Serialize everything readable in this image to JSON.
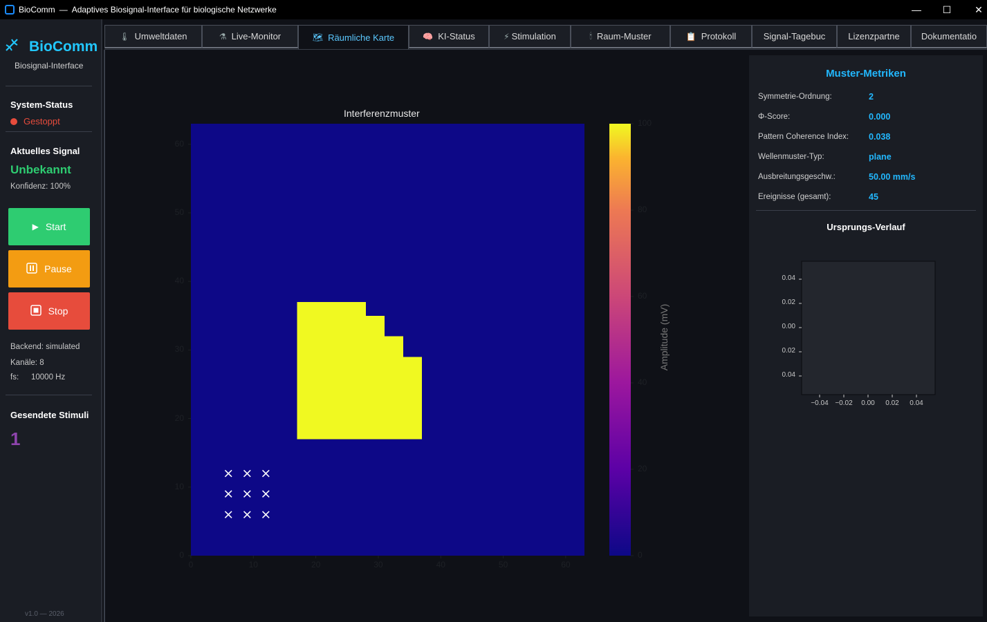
{
  "window": {
    "app_name": "BioComm",
    "separator": "—",
    "title": "Adaptives Biosignal-Interface für biologische Netzwerke",
    "minimize": "—",
    "maximize": "☐",
    "close": "✕"
  },
  "sidebar": {
    "logo": "BioComm",
    "subtitle": "Biosignal-Interface",
    "system_status_title": "System-Status",
    "status": "Gestoppt",
    "status_color": "#e74c3c",
    "current_signal_title": "Aktuelles Signal",
    "signal_value": "Unbekannt",
    "confidence": "Konfidenz: 100%",
    "buttons": {
      "start": "Start",
      "pause": "Pause",
      "stop": "Stop"
    },
    "backend": "Backend: simulated",
    "channels": "Kanäle:  8",
    "fs_label": "fs:",
    "fs_value": "10000 Hz",
    "stimuli_title": "Gesendete Stimuli",
    "stimuli_count": "1",
    "version": "v1.0  —  2026"
  },
  "tabs": [
    {
      "label": "Umweltdaten",
      "icon": "🌡"
    },
    {
      "label": "Live-Monitor",
      "icon": "⚗"
    },
    {
      "label": "Räumliche Karte",
      "icon": "🗺"
    },
    {
      "label": "KI-Status",
      "icon": "🧠"
    },
    {
      "label": "Stimulation",
      "icon": "⚡"
    },
    {
      "label": "Raum-Muster",
      "icon": "🕯"
    },
    {
      "label": "Protokoll",
      "icon": "📋"
    },
    {
      "label": "Signal-Tagebuc",
      "icon": ""
    },
    {
      "label": "Lizenzpartne",
      "icon": ""
    },
    {
      "label": "Dokumentatio",
      "icon": ""
    }
  ],
  "active_tab": "Räumliche Karte",
  "chart_data": [
    {
      "type": "heatmap",
      "title": "Interferenzmuster",
      "x_ticks": [
        "0",
        "10",
        "20",
        "30",
        "40",
        "50",
        "60"
      ],
      "y_ticks": [
        "0",
        "10",
        "20",
        "30",
        "40",
        "50",
        "60"
      ],
      "xlim": [
        0,
        63
      ],
      "ylim": [
        0,
        63
      ],
      "colormap": "plasma",
      "colorbar_label": "Amplitude (mV)",
      "colorbar_ticks": [
        "0",
        "20",
        "40",
        "60",
        "80",
        "100"
      ],
      "colorbar_range": [
        0,
        100
      ],
      "background_value": 0,
      "region_value": 100,
      "high_region_rows": [
        {
          "y": [
            17,
            29
          ],
          "x": [
            17,
            37
          ]
        },
        {
          "y": [
            29,
            32
          ],
          "x": [
            17,
            34
          ]
        },
        {
          "y": [
            32,
            35
          ],
          "x": [
            17,
            31
          ]
        },
        {
          "y": [
            35,
            37
          ],
          "x": [
            17,
            28
          ]
        }
      ],
      "electrode_markers": {
        "symbol": "×",
        "x": [
          6,
          9,
          12
        ],
        "y": [
          6,
          9,
          12
        ]
      }
    },
    {
      "type": "scatter",
      "title": "Ursprungs-Verlauf",
      "x_ticks": [
        "−0.04",
        "−0.02",
        "0.00",
        "0.02",
        "0.04"
      ],
      "y_ticks": [
        "0.04",
        "0.02",
        "0.00",
        "0.02",
        "0.04"
      ],
      "xlim": [
        -0.05,
        0.05
      ],
      "ylim": [
        -0.05,
        0.05
      ],
      "series": []
    }
  ],
  "metrics": {
    "title": "Muster-Metriken",
    "rows": [
      {
        "label": "Symmetrie-Ordnung:",
        "value": "2"
      },
      {
        "label": "Φ-Score:",
        "value": "0.000"
      },
      {
        "label": "Pattern Coherence Index:",
        "value": "0.038"
      },
      {
        "label": "Wellenmuster-Typ:",
        "value": "plane"
      },
      {
        "label": "Ausbreitungsgeschw.:",
        "value": "50.00 mm/s"
      },
      {
        "label": "Ereignisse (gesamt):",
        "value": "45"
      }
    ],
    "origin_title": "Ursprungs-Verlauf"
  },
  "colors": {
    "accent": "#22b8ff",
    "start": "#2ecc71",
    "pause": "#f39c12",
    "stop": "#e74c3c",
    "heat_low": "#0d0887",
    "heat_high": "#f0f921"
  }
}
